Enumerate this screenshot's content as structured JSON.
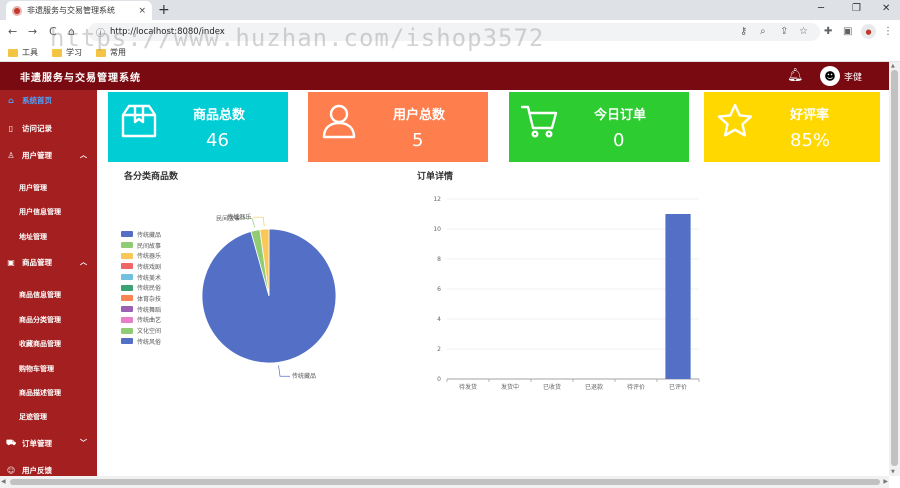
{
  "browser": {
    "tab_title": "非遗服务与交易管理系统",
    "tab_close": "×",
    "new_tab": "+",
    "controls": {
      "minimize": "─",
      "restore": "❐",
      "close": "✕"
    },
    "nav": {
      "back": "←",
      "forward": "→",
      "reload": "C",
      "home": "⌂"
    },
    "url": "http://localhost:8080/index",
    "bookmarks": [
      {
        "label": "工具"
      },
      {
        "label": "学习"
      },
      {
        "label": "常用"
      }
    ]
  },
  "watermark": "https://www.huzhan.com/ishop3572",
  "header": {
    "title": "非遗服务与交易管理系统",
    "user_name": "李健",
    "bell_icon": "bell-icon"
  },
  "sidebar": {
    "home": "系统首页",
    "visit_log": "访问记录",
    "user_mgmt": {
      "label": "用户管理",
      "children": [
        "用户管理",
        "用户信息管理",
        "地址管理"
      ]
    },
    "goods_mgmt": {
      "label": "商品管理",
      "children": [
        "商品信息管理",
        "商品分类管理",
        "收藏商品管理",
        "购物车管理",
        "商品描述管理",
        "足迹管理"
      ]
    },
    "order_mgmt": "订单管理",
    "feedback": "用户反馈"
  },
  "cards": [
    {
      "label": "商品总数",
      "value": "46",
      "color": "#00cdd4",
      "icon": "box-icon"
    },
    {
      "label": "用户总数",
      "value": "5",
      "color": "#fe7e4d",
      "icon": "user-icon"
    },
    {
      "label": "今日订单",
      "value": "0",
      "color": "#2dcc31",
      "icon": "cart-icon"
    },
    {
      "label": "好评率",
      "value": "85%",
      "color": "#ffd800",
      "icon": "star-icon"
    }
  ],
  "chart_data": [
    {
      "type": "pie",
      "title": "各分类商品数",
      "legend_position": "left",
      "categories": [
        "传统藏品",
        "民间故事",
        "传统器乐",
        "传统戏剧",
        "传统美术",
        "传统民俗",
        "体育杂技",
        "传统舞蹈",
        "传统曲艺",
        "文化空间",
        "传统风俗"
      ],
      "colors": [
        "#5470c6",
        "#91cc75",
        "#fac858",
        "#ee6666",
        "#73c0de",
        "#3ba272",
        "#fc8452",
        "#9a60b4",
        "#ea7ccc",
        "#91cc75",
        "#5470c6"
      ],
      "values": [
        44,
        1,
        1,
        0,
        0,
        0,
        0,
        0,
        0,
        0,
        0
      ],
      "slice_labels": [
        "传统藏品",
        "民间故事",
        "传统器乐"
      ]
    },
    {
      "type": "bar",
      "title": "订单详情",
      "categories": [
        "待发货",
        "发货中",
        "已收货",
        "已退款",
        "待评价",
        "已评价"
      ],
      "values": [
        0,
        0,
        0,
        0,
        0,
        11
      ],
      "ylim": [
        0,
        12
      ],
      "yticks": [
        0,
        2,
        4,
        6,
        8,
        10,
        12
      ],
      "color": "#5470c6",
      "grid": true
    }
  ]
}
